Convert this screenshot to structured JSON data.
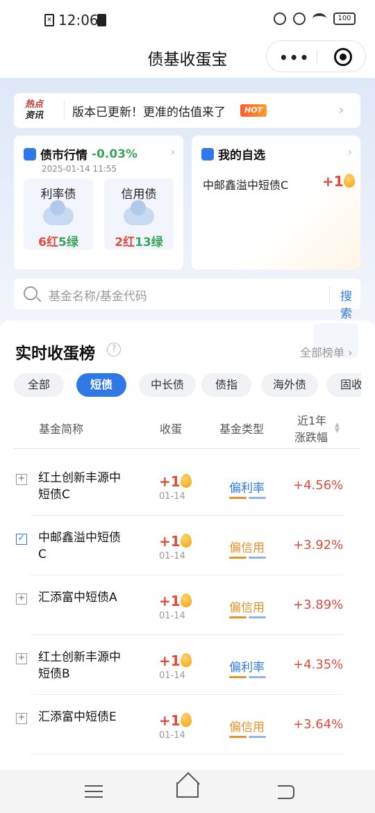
{
  "status_bar": {
    "time": "12:06",
    "battery": "100"
  },
  "header": {
    "title": "债基收蛋宝",
    "more": "•••"
  },
  "notice": {
    "tag_line1": "热点",
    "tag_line2": "资讯",
    "message": "版本已更新！更准的估值来了",
    "badge": "HOT"
  },
  "market": {
    "title": "债市行情",
    "change": "-0.03%",
    "date": "2025-01-14 11:55",
    "rate_bond": {
      "label": "利率债",
      "red": "6红",
      "green": "5绿"
    },
    "credit_bond": {
      "label": "信用债",
      "red": "2红",
      "green": "13绿"
    }
  },
  "watchlist": {
    "title": "我的自选",
    "fund": "中邮鑫溢中短债C",
    "eggs": "+1"
  },
  "search": {
    "placeholder": "基金名称/基金代码",
    "button": "搜索"
  },
  "ranking": {
    "title": "实时收蛋榜",
    "all_link": "全部榜单 ›",
    "tabs": [
      "全部",
      "短债",
      "中长债",
      "债指",
      "海外债",
      "固收"
    ],
    "active_tab": "短债",
    "columns": {
      "name": "基金简称",
      "eggs": "收蛋",
      "type": "基金类型",
      "change_l1": "近1年",
      "change_l2": "涨跌幅"
    },
    "rows": [
      {
        "name": "红土创新丰源中短债C",
        "eggs": "+1",
        "date": "01-14",
        "type": "偏利率",
        "change": "+4.56%",
        "checked": false
      },
      {
        "name": "中邮鑫溢中短债C",
        "eggs": "+1",
        "date": "01-14",
        "type": "偏信用",
        "change": "+3.92%",
        "checked": true
      },
      {
        "name": "汇添富中短债A",
        "eggs": "+1",
        "date": "01-14",
        "type": "偏信用",
        "change": "+3.89%",
        "checked": false
      },
      {
        "name": "红土创新丰源中短债B",
        "eggs": "+1",
        "date": "01-14",
        "type": "偏利率",
        "change": "+4.35%",
        "checked": false
      },
      {
        "name": "汇添富中短债E",
        "eggs": "+1",
        "date": "01-14",
        "type": "偏信用",
        "change": "+3.64%",
        "checked": false
      }
    ]
  },
  "colors": {
    "accent": "#2f78e5",
    "up": "#e04a3c",
    "down": "#3aa55b",
    "credit": "#e8912a"
  }
}
